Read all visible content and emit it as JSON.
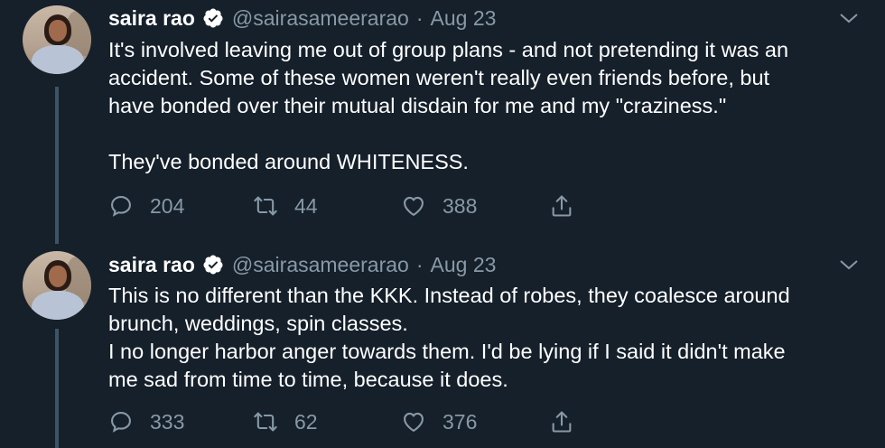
{
  "tweets": [
    {
      "author": {
        "name": "saira rao",
        "handle": "@sairasameerarao",
        "verified": true
      },
      "separator": "·",
      "date": "Aug 23",
      "lines": [
        "It's involved leaving me out of group plans - and not pretending it was an",
        "accident. Some of these women weren't really even friends before, but",
        "have bonded over their mutual disdain for me and my \"craziness.\"",
        "",
        "They've bonded around WHITENESS."
      ],
      "stats": {
        "replies": "204",
        "retweets": "44",
        "likes": "388"
      }
    },
    {
      "author": {
        "name": "saira rao",
        "handle": "@sairasameerarao",
        "verified": true
      },
      "separator": "·",
      "date": "Aug 23",
      "lines": [
        "This is no different than the KKK. Instead of robes, they coalesce around",
        "brunch, weddings, spin classes.",
        "I no longer harbor anger towards them. I'd be lying if I said it didn't make",
        "me sad from time to time, because it does."
      ],
      "stats": {
        "replies": "333",
        "retweets": "62",
        "likes": "376"
      }
    }
  ],
  "colors": {
    "background": "#15202b",
    "primary_text": "#ffffff",
    "secondary_text": "#8899a6",
    "thread_line": "#3d5466"
  },
  "icons": [
    "verified-badge-icon",
    "chevron-down-icon",
    "reply-icon",
    "retweet-icon",
    "like-icon",
    "share-icon"
  ]
}
